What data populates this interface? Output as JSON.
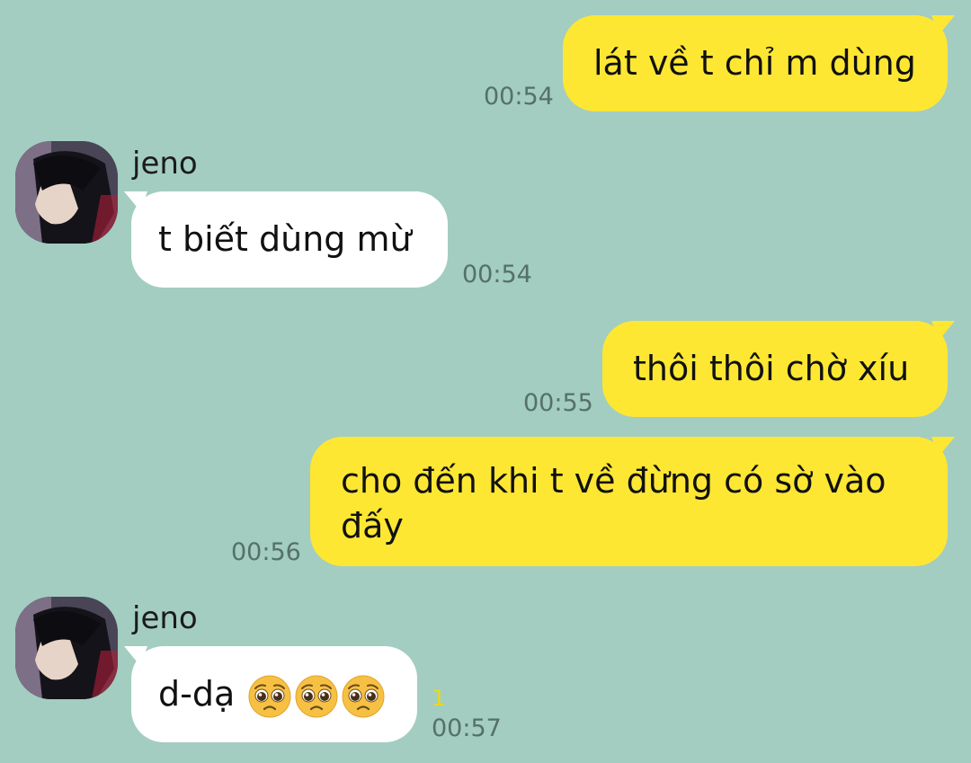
{
  "messages": [
    {
      "from": "me",
      "text": "lát về t chỉ m dùng",
      "time": "00:54"
    },
    {
      "from": "jeno",
      "sender": "jeno",
      "text": "t biết dùng mừ",
      "time": "00:54"
    },
    {
      "from": "me",
      "text": "thôi thôi chờ xíu",
      "time": "00:55"
    },
    {
      "from": "me",
      "text": "cho đến khi t về đừng có sờ vào đấy",
      "time": "00:56"
    },
    {
      "from": "jeno",
      "sender": "jeno",
      "text": "d-dạ",
      "emoji": [
        "pleading-face-icon",
        "pleading-face-icon",
        "pleading-face-icon"
      ],
      "unread": "1",
      "time": "00:57"
    }
  ],
  "colors": {
    "background": "#a3cdc0",
    "my_bubble": "#fee733",
    "their_bubble": "#ffffff",
    "unread": "#e9d820"
  }
}
